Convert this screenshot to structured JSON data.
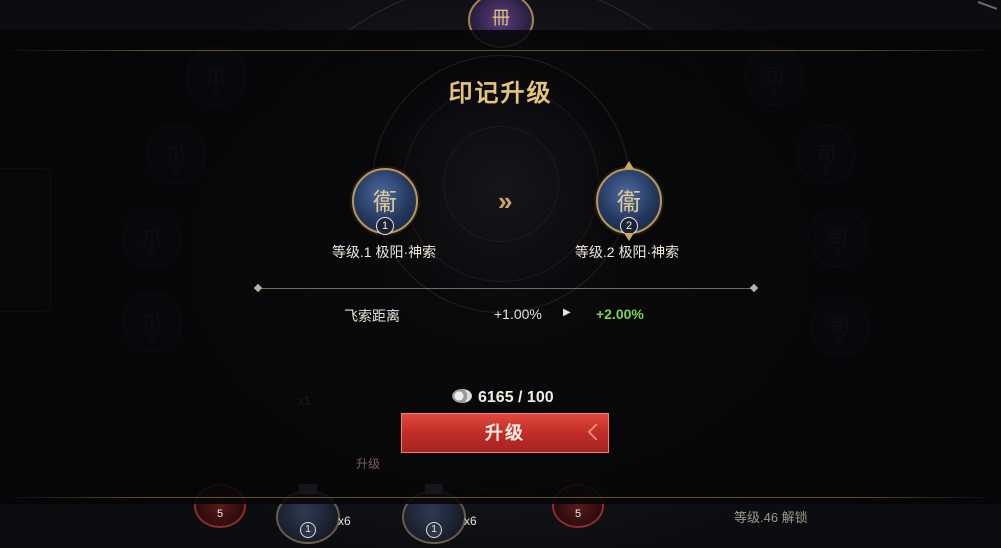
{
  "modal": {
    "title": "印记升级",
    "current": {
      "glyph": "衞",
      "level_badge": "1",
      "label": "等级.1  极阳·神索"
    },
    "next": {
      "glyph": "衞",
      "level_badge": "2",
      "label": "等级.2  极阳·神索"
    },
    "arrows": "»",
    "stat": {
      "name": "飞索距离",
      "old_value": "+1.00%",
      "play": "▶",
      "new_value": "+2.00%"
    },
    "cost": {
      "icon": "currency-icon",
      "text": "6165 / 100"
    },
    "upgrade_label": "升级"
  },
  "background": {
    "unlock_text": "等级.46 解锁",
    "under_button_text": "升级",
    "counts": [
      "x6",
      "x6",
      "x1"
    ],
    "rune_levels": [
      "5",
      "5",
      "5",
      "5",
      "5",
      "5",
      "5",
      "5"
    ],
    "bottom_badges": [
      "1",
      "1"
    ],
    "red_badges": [
      "5",
      "5"
    ]
  },
  "colors": {
    "title_gold": "#e6c47a",
    "increase_green": "#7fd35a",
    "button_red": "#c22d27"
  }
}
